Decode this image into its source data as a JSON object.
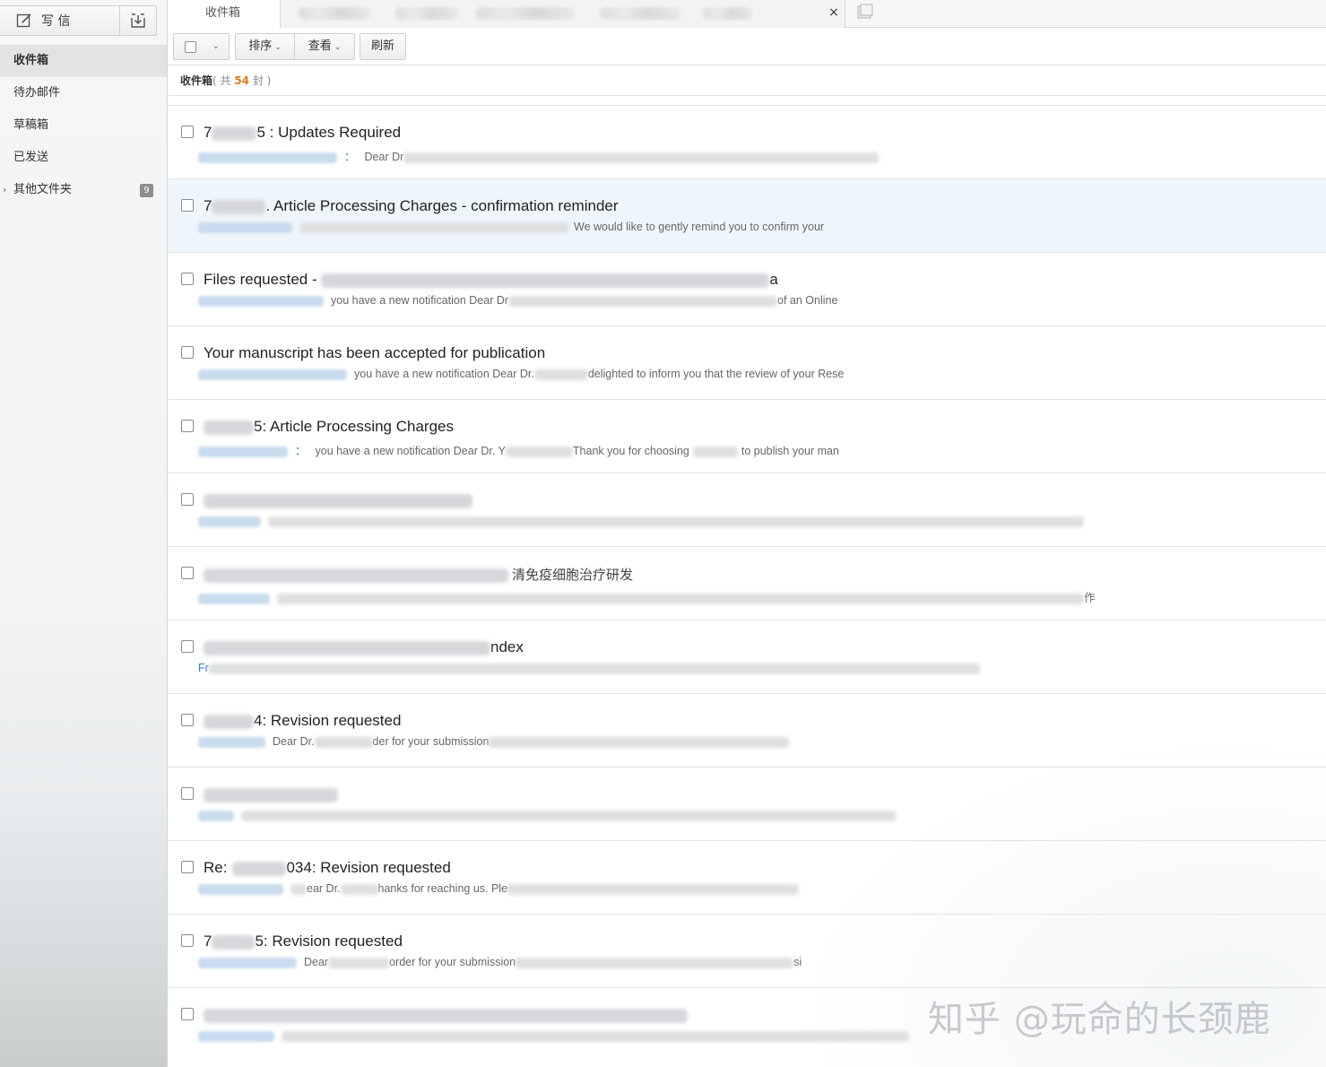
{
  "sidebar": {
    "compose_label": "写 信",
    "compose_icon": "compose-icon",
    "receive_icon": "receive-mail-icon",
    "folders": [
      {
        "label": "收件箱",
        "active": true
      },
      {
        "label": "待办邮件"
      },
      {
        "label": "草稿箱"
      },
      {
        "label": "已发送"
      },
      {
        "label": "其他文件夹",
        "count": "9"
      }
    ]
  },
  "tabs": {
    "inbox_label": "收件箱",
    "close_label": "×"
  },
  "toolbar": {
    "sort_label": "排序",
    "view_label": "查看",
    "refresh_label": "刷新"
  },
  "list_header": {
    "folder": "收件箱",
    "prefix": "( 共 ",
    "count": "54",
    "suffix": " 封 )"
  },
  "mails": [
    {
      "subject_pre": "7",
      "subject": "5 : Updates Required",
      "preview_pre": "：",
      "preview": "Dear Dr"
    },
    {
      "subject_pre": "7",
      "subject": ". Article Processing Charges - confirmation reminder",
      "preview_pre": "",
      "preview": "We would like to gently remind you to confirm your"
    },
    {
      "subject_pre": "",
      "subject": "Files requested - ",
      "subject_tail": "a",
      "preview_pre": "",
      "preview": "you have a new notification Dear Dr",
      "preview_tail": "of an Online"
    },
    {
      "subject_pre": "",
      "subject": "Your manuscript has been accepted for publication",
      "preview_pre": "",
      "preview": "you have a new notification Dear Dr.",
      "preview_tail": "delighted to inform you that the review of your Rese"
    },
    {
      "subject_pre": "",
      "subject": "5: Article Processing Charges",
      "preview_pre": "：",
      "preview": "you have a new notification Dear Dr. Y",
      "preview_tail": "Thank you for choosing",
      "preview_tail2": "to publish your man"
    },
    {
      "subject_pre": "",
      "subject": "",
      "preview_pre": "",
      "preview": ""
    },
    {
      "subject_pre": "",
      "subject": "",
      "subject_tail": "清免疫细胞治疗研发",
      "preview_pre": "",
      "preview": "",
      "preview_tail": "作"
    },
    {
      "subject_pre": "",
      "subject": "",
      "subject_tail": "ndex",
      "preview_pre": "Fr",
      "preview": ""
    },
    {
      "subject_pre": "",
      "subject": "4: Revision requested",
      "preview_pre": "",
      "preview": "Dear Dr.",
      "preview_tail": "der for your submission"
    },
    {
      "subject_pre": "",
      "subject": "",
      "preview_pre": "",
      "preview": ""
    },
    {
      "subject_pre": "Re:",
      "subject": "034: Revision requested",
      "preview_pre": "",
      "preview": "ear Dr.",
      "preview_tail": "hanks for reaching us. Ple"
    },
    {
      "subject_pre": "7",
      "subject": "5: Revision requested",
      "preview_pre": "",
      "preview": "Dear",
      "preview_tail": "order for your submission",
      "preview_tail2": "si"
    },
    {
      "subject_pre": "",
      "subject": "",
      "preview_pre": "",
      "preview": ""
    }
  ],
  "watermark": "知乎 @玩命的长颈鹿"
}
